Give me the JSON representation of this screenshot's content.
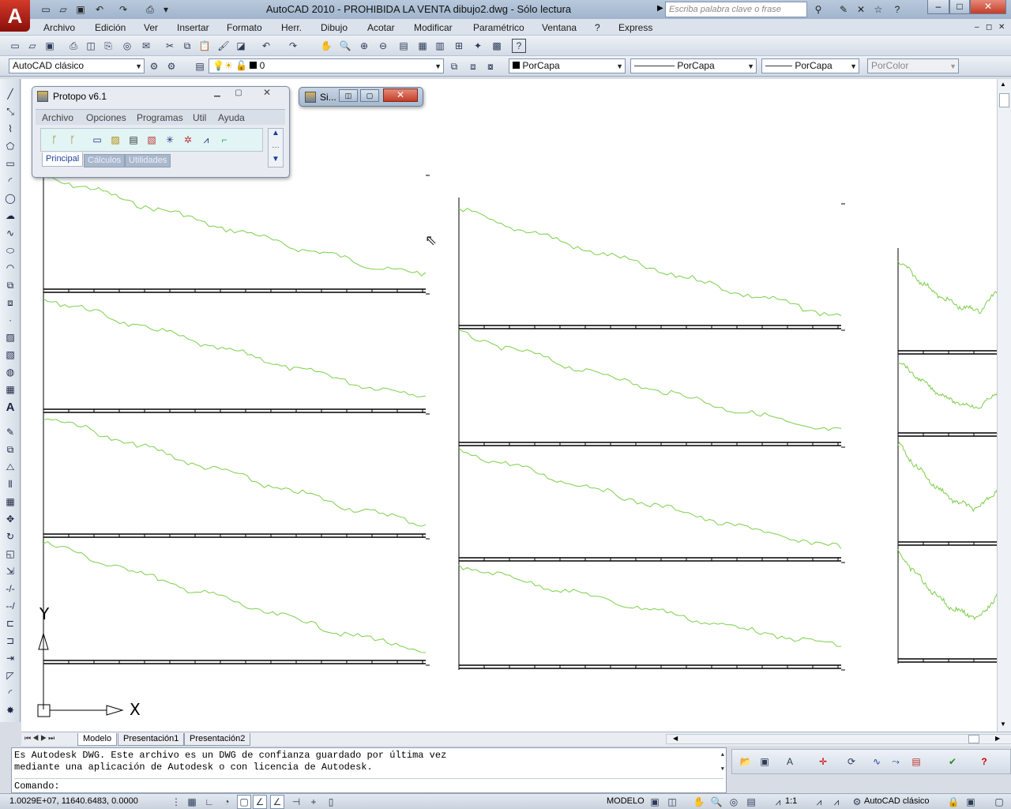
{
  "window": {
    "title": "AutoCAD 2010 - PROHIBIDA LA VENTA     dibujo2.dwg - Sólo lectura",
    "search_placeholder": "Escriba palabra clave o frase",
    "logo": "A"
  },
  "menu": [
    "Archivo",
    "Edición",
    "Ver",
    "Insertar",
    "Formato",
    "Herr.",
    "Dibujo",
    "Acotar",
    "Modificar",
    "Paramétrico",
    "Ventana",
    "?",
    "Express"
  ],
  "toolbar2": {
    "workspace": "AutoCAD clásico",
    "layer": "0",
    "color": "PorCapa",
    "linetype": "PorCapa",
    "lineweight": "PorCapa",
    "plotstyle": "PorColor"
  },
  "protopo": {
    "title": "Protopo v6.1",
    "menu": [
      "Archivo",
      "Opciones",
      "Programas",
      "Util",
      "Ayuda"
    ],
    "tabs": [
      "Principal",
      "Cálculos",
      "Utilidades"
    ]
  },
  "si_window": {
    "title": "Si..."
  },
  "ucs": {
    "x_label": "X",
    "y_label": "Y"
  },
  "layout_tabs": [
    "Modelo",
    "Presentación1",
    "Presentación2"
  ],
  "command": {
    "line1": "Es Autodesk DWG. Este archivo es un DWG de confianza guardado por última vez",
    "line2": "mediante una aplicación de Autodesk o con licencia de Autodesk.",
    "prompt": "Comando:"
  },
  "status": {
    "coords": "1.0029E+07, 11640.6483, 0.0000",
    "model": "MODELO",
    "scale": "1:1",
    "workspace": "AutoCAD clásico"
  },
  "colors": {
    "profile_line": "#7ccf4a",
    "drawing_bg": "#ffffff"
  }
}
